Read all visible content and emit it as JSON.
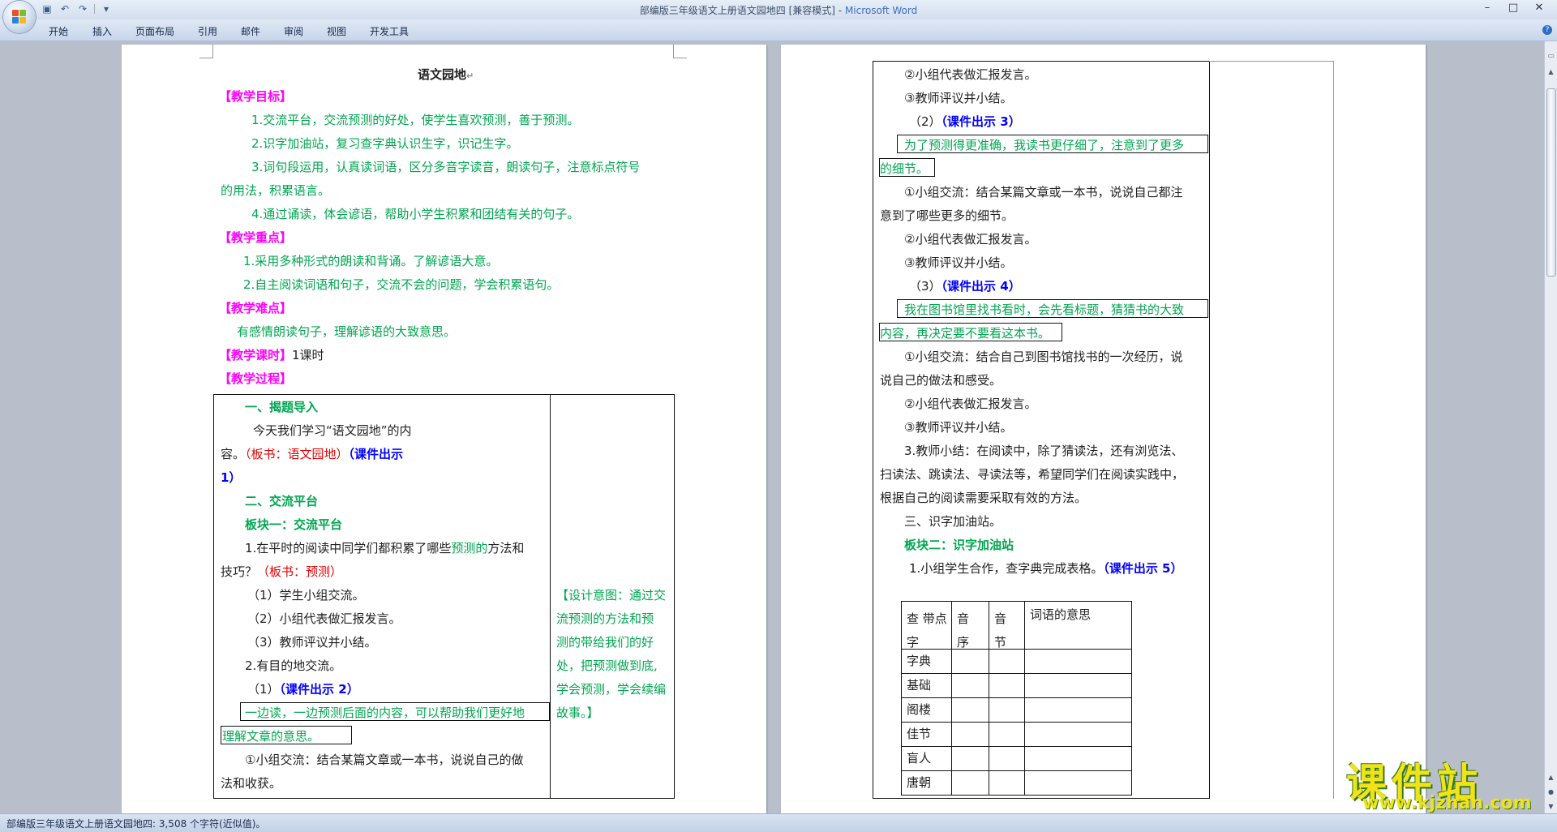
{
  "window": {
    "title": "部编版三年级语文上册语文园地四 [兼容模式]",
    "app_name": "Microsoft Word",
    "controls": [
      "–",
      "□",
      "✕"
    ]
  },
  "quick_access": {
    "icons": [
      "save-icon",
      "undo-icon",
      "redo-icon",
      "customize-icon"
    ]
  },
  "ribbon": {
    "tabs": [
      "开始",
      "插入",
      "页面布局",
      "引用",
      "邮件",
      "审阅",
      "视图",
      "开发工具"
    ]
  },
  "page1": {
    "title": "语文园地",
    "h_goal": "【教学目标】",
    "goal1": "1.交流平台，交流预测的好处，使学生喜欢预测，善于预测。",
    "goal2": "2.识字加油站，复习查字典认识生字，识记生字。",
    "goal3a": "3.词句段运用，认真读词语，区分多音字读音，朗读句子，注意标点符号",
    "goal3b": "的用法，积累语言。",
    "goal4": "4.通过诵读，体会谚语，帮助小学生积累和团结有关的句子。",
    "h_key": "【教学重点】",
    "key1": "1.采用多种形式的朗读和背诵。了解谚语大意。",
    "key2": "2.自主阅读词语和句子，交流不会的问题，学会积累语句。",
    "h_diff": "【教学难点】",
    "diff1": "有感情朗读句子，理解谚语的大致意思。",
    "h_hours": "【教学课时】",
    "hours": "1课时",
    "h_process": "【教学过程】",
    "sec1": "一、揭题导入",
    "intro_a": "今天我们学习“语文园地”的内",
    "intro_b1": "容。",
    "intro_b2": "（板书：语文园地）",
    "intro_b3": "（课件出示",
    "intro_c": "1）",
    "sec2": "二、交流平台",
    "block1": "板块一：交流平台",
    "q1a_1": "1.在平时的阅读中同学们都积累了哪些",
    "q1a_2": "预测的",
    "q1a_3": "方法和",
    "q1b_1": "技巧？",
    "q1b_2": "（板书：预测）",
    "s1": "（1）学生小组交流。",
    "s2": "（2）小组代表做汇报发言。",
    "s3": "（3）教师评议并小结。",
    "q2": "2.有目的地交流。",
    "sub1a": "（1）",
    "sub1b": "（课件出示 2）",
    "quote1a": "一边读，一边预测后面的内容，可以帮助我们更好地",
    "quote1b": "理解文章的意思。",
    "grp1a": "①小组交流：结合某篇文章或一本书，说说自己的做",
    "grp1b": "法和收获。",
    "design": [
      "【设计意图：通过交",
      "流预测的方法和预",
      "测的带给我们的好",
      "处，把预测做到底,",
      "学会预测，学会续编",
      "故事。】"
    ]
  },
  "page2": {
    "l1": "②小组代表做汇报发言。",
    "l2": "③教师评议并小结。",
    "sub2a": "（2）",
    "sub2b": "（课件出示 3）",
    "quote2a": "为了预测得更准确，我读书更仔细了，注意到了更多",
    "quote2b": "的细节。",
    "l3a": "①小组交流：结合某篇文章或一本书，说说自己都注",
    "l3b": "意到了哪些更多的细节。",
    "l4": "②小组代表做汇报发言。",
    "l5": "③教师评议并小结。",
    "sub3a": "（3）",
    "sub3b": "（课件出示 4）",
    "quote3a": "我在图书馆里找书看时，会先看标题，猜猜书的大致",
    "quote3b": "内容，再决定要不要看这本书。",
    "l6a": "①小组交流：结合自己到图书馆找书的一次经历，说",
    "l6b": "说自己的做法和感受。",
    "l7": "②小组代表做汇报发言。",
    "l8": "③教师评议并小结。",
    "l9a": "3.教师小结：在阅读中，除了猜读法，还有浏览法、",
    "l9b": "扫读法、跳读法、寻读法等，希望同学们在阅读实践中，",
    "l9c": "根据自己的阅读需要采取有效的方法。",
    "sec3": "三、识字加油站。",
    "block2": "板块二：识字加油站",
    "task1a": "1.小组学生合作，查字典完成表格。",
    "task1b": "（课件出示 5）",
    "table_headers": [
      "查 带点字",
      "音序",
      "音节",
      "词语的意思"
    ],
    "table_rows": [
      "字典",
      "基础",
      "阁楼",
      "佳节",
      "盲人",
      "唐朝"
    ]
  },
  "status": {
    "text": "部编版三年级语文上册语文园地四: 3,508 个字符(近似值)。"
  },
  "watermark": {
    "cn": "课件站",
    "url": "www.kjzhan.com"
  },
  "colors": {
    "green": "#00a650",
    "magenta": "#ff00ff",
    "blue": "#0000ff",
    "red": "#e30000"
  }
}
